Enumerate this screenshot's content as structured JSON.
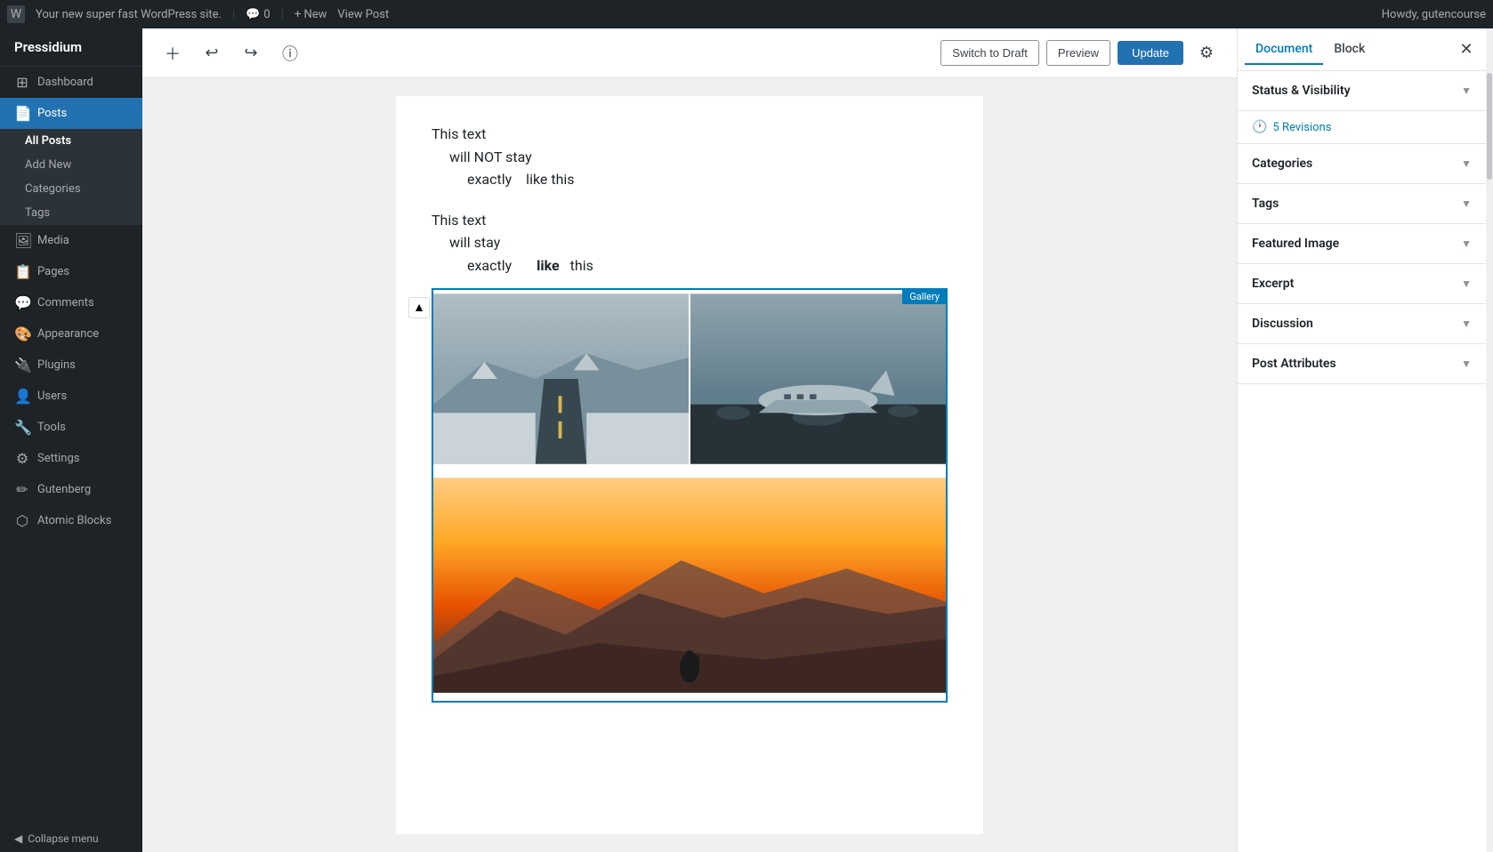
{
  "adminBar": {
    "logoSymbol": "W",
    "siteName": "Your new super fast WordPress site.",
    "commentsLabel": "Comments",
    "commentsCount": "0",
    "newLabel": "+ New",
    "viewPostLabel": "View Post",
    "howdyLabel": "Howdy, gutencourse"
  },
  "sidebar": {
    "brand": "Pressidium",
    "items": [
      {
        "id": "dashboard",
        "label": "Dashboard",
        "icon": "⊞"
      },
      {
        "id": "posts",
        "label": "Posts",
        "icon": "📄",
        "active": true
      },
      {
        "id": "posts-allposts",
        "label": "All Posts",
        "sub": true,
        "current": true
      },
      {
        "id": "posts-addnew",
        "label": "Add New",
        "sub": true
      },
      {
        "id": "posts-categories",
        "label": "Categories",
        "sub": true
      },
      {
        "id": "posts-tags",
        "label": "Tags",
        "sub": true
      },
      {
        "id": "media",
        "label": "Media",
        "icon": "🖼"
      },
      {
        "id": "pages",
        "label": "Pages",
        "icon": "📋"
      },
      {
        "id": "comments",
        "label": "Comments",
        "icon": "💬"
      },
      {
        "id": "appearance",
        "label": "Appearance",
        "icon": "🎨"
      },
      {
        "id": "plugins",
        "label": "Plugins",
        "icon": "🔌"
      },
      {
        "id": "users",
        "label": "Users",
        "icon": "👤"
      },
      {
        "id": "tools",
        "label": "Tools",
        "icon": "🔧"
      },
      {
        "id": "settings",
        "label": "Settings",
        "icon": "⚙"
      },
      {
        "id": "gutenberg",
        "label": "Gutenberg",
        "icon": "✏"
      },
      {
        "id": "atomic-blocks",
        "label": "Atomic Blocks",
        "icon": "⬡"
      }
    ],
    "collapse": "Collapse menu"
  },
  "toolbar": {
    "addBlockIcon": "+",
    "undoIcon": "↩",
    "redoIcon": "↪",
    "infoIcon": "ⓘ",
    "switchToDraftLabel": "Switch to Draft",
    "previewLabel": "Preview",
    "updateLabel": "Update",
    "gearIcon": "⚙"
  },
  "editorContent": {
    "textBlock1": {
      "line1": "This text",
      "line2": "will NOT stay",
      "line3part1": "exactly",
      "line3part2": "like this"
    },
    "textBlock2": {
      "line1": "This text",
      "line2": "will stay",
      "line3part1": "exactly",
      "line3part2": "like",
      "line3part3": "this"
    },
    "galleryLabel": "Gallery",
    "images": [
      {
        "id": "road",
        "alt": "Road through snowy landscape",
        "type": "road"
      },
      {
        "id": "plane",
        "alt": "Plane wreckage on dark beach",
        "type": "plane"
      },
      {
        "id": "mountain",
        "alt": "Person on mountain at golden hour",
        "type": "mountain"
      }
    ]
  },
  "rightPanel": {
    "documentTab": "Document",
    "blockTab": "Block",
    "closeIcon": "✕",
    "sections": [
      {
        "id": "status-visibility",
        "label": "Status & Visibility",
        "expanded": true
      },
      {
        "id": "revisions",
        "label": "5 Revisions",
        "isRevisions": true
      },
      {
        "id": "categories",
        "label": "Categories",
        "expanded": false
      },
      {
        "id": "tags",
        "label": "Tags",
        "expanded": false
      },
      {
        "id": "featured-image",
        "label": "Featured Image",
        "expanded": false
      },
      {
        "id": "excerpt",
        "label": "Excerpt",
        "expanded": false
      },
      {
        "id": "discussion",
        "label": "Discussion",
        "expanded": false
      },
      {
        "id": "post-attributes",
        "label": "Post Attributes",
        "expanded": false
      }
    ]
  }
}
